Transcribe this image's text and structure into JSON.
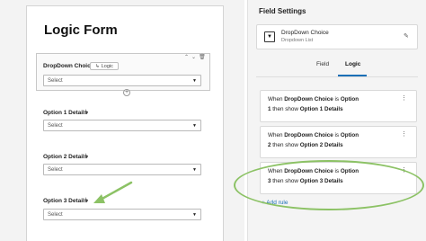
{
  "form": {
    "title": "Logic Form",
    "field1": {
      "label": "DropDown Choice",
      "logic_chip": "Logic",
      "select_placeholder": "Select"
    },
    "field2": {
      "label": "Option 1 Details",
      "select_placeholder": "Select"
    },
    "field3": {
      "label": "Option 2 Details",
      "select_placeholder": "Select"
    },
    "field4": {
      "label": "Option 3 Details",
      "select_placeholder": "Select"
    }
  },
  "panel": {
    "title": "Field Settings",
    "field_type": {
      "name": "DropDown Choice",
      "sub": "Dropdown List"
    },
    "tabs": [
      {
        "label": "Field"
      },
      {
        "label": "Logic",
        "active": true
      }
    ],
    "rules": [
      {
        "p1": "When ",
        "b1": "DropDown Choice",
        "p2": " is ",
        "b2": "Option",
        "n": "1",
        "p3": " then show ",
        "b3": "Option 1 Details"
      },
      {
        "p1": "When ",
        "b1": "DropDown Choice",
        "p2": " is ",
        "b2": "Option",
        "n": "2",
        "p3": " then show ",
        "b3": "Option 2 Details"
      },
      {
        "p1": "When ",
        "b1": "DropDown Choice",
        "p2": " is ",
        "b2": "Option",
        "n": "3",
        "p3": " then show ",
        "b3": "Option 3 Details"
      }
    ],
    "add_rule": "+ Add rule"
  },
  "colors": {
    "accent": "#1b6fb6",
    "highlight": "#8cc265"
  },
  "icons": [
    "logic-branch-icon",
    "chevron-up-icon",
    "chevron-down-icon",
    "delete-icon",
    "add-icon",
    "dropdown-type-icon",
    "edit-icon",
    "more-vertical-icon",
    "caret-down-icon"
  ]
}
